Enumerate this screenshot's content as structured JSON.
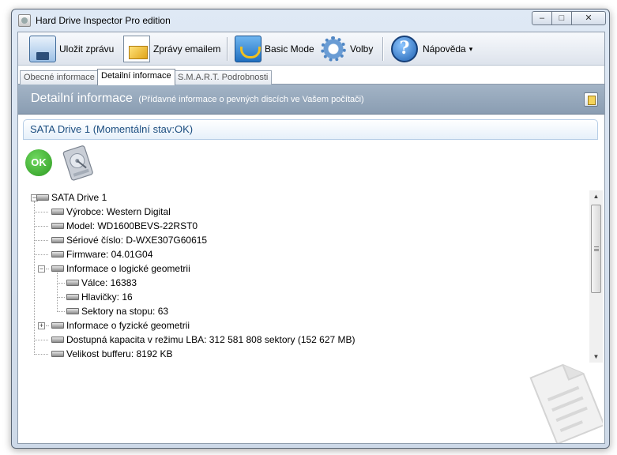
{
  "window": {
    "title": "Hard Drive Inspector Pro edition"
  },
  "toolbar": {
    "save_label": "Uložit zprávu",
    "email_label": "Zprávy emailem",
    "basic_label": "Basic Mode",
    "options_label": "Volby",
    "help_label": "Nápověda",
    "help_arrow": "▾"
  },
  "tabs": [
    {
      "label": "Obecné informace",
      "active": false
    },
    {
      "label": "Detailní informace",
      "active": true
    },
    {
      "label": "S.M.A.R.T. Podrobnosti",
      "active": false
    }
  ],
  "section": {
    "title": "Detailní informace",
    "subtitle": "(Přídavné informace o pevných discích ve Vašem počítači)"
  },
  "drive": {
    "header": "SATA Drive 1 (Momentální stav:OK)",
    "status": "OK"
  },
  "tree": {
    "root": "SATA Drive 1",
    "items": [
      "Výrobce: Western Digital",
      "Model: WD1600BEVS-22RST0",
      "Sériové číslo: D-WXE307G60615",
      "Firmware: 04.01G04",
      "Informace o logické geometrii",
      "Válce: 16383",
      "Hlavičky: 16",
      "Sektory na stopu: 63",
      "Informace o fyzické geometrii",
      "Dostupná kapacita v režimu LBA: 312 581 808 sektory (152 627 MB)",
      "Velikost bufferu: 8192 KB"
    ],
    "expand_collapse": {
      "root": "−",
      "logical": "−",
      "physical": "+"
    }
  },
  "icons": {
    "save": "save-report-icon",
    "email": "email-report-icon",
    "basic": "basic-mode-icon",
    "options": "gear-icon",
    "help": "help-icon",
    "hdd": "hard-drive-icon"
  },
  "colors": {
    "header_bg": "#97a9bd",
    "drive_header_text": "#1c4e80",
    "ok_green": "#3cb12f"
  }
}
